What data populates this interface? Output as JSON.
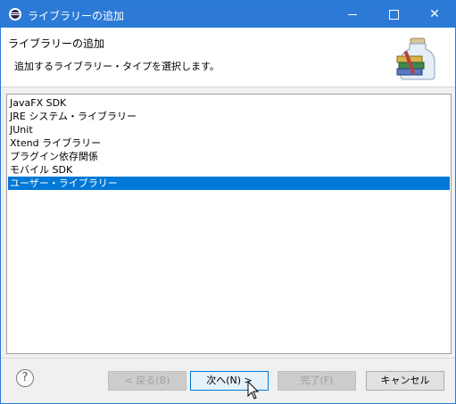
{
  "window": {
    "title": "ライブラリーの追加",
    "controls": {
      "minimize": "minimize",
      "maximize": "maximize",
      "close": "✕"
    }
  },
  "header": {
    "title": "ライブラリーの追加",
    "description": "追加するライブラリー・タイプを選択します。",
    "image_icon": "library-jar-icon"
  },
  "library_types": {
    "items": [
      {
        "label": "JavaFX SDK",
        "selected": false
      },
      {
        "label": "JRE システム・ライブラリー",
        "selected": false
      },
      {
        "label": "JUnit",
        "selected": false
      },
      {
        "label": "Xtend ライブラリー",
        "selected": false
      },
      {
        "label": "プラグイン依存関係",
        "selected": false
      },
      {
        "label": "モバイル SDK",
        "selected": false
      },
      {
        "label": "ユーザー・ライブラリー",
        "selected": true
      }
    ]
  },
  "buttons": {
    "help": "?",
    "back": "< 戻る(B)",
    "next": "次へ(N) >",
    "finish": "完了(F)",
    "cancel": "キャンセル"
  },
  "colors": {
    "titlebar": "#2c7ad6",
    "selection": "#0078d7",
    "dialog_bg": "#f0f0f0"
  }
}
